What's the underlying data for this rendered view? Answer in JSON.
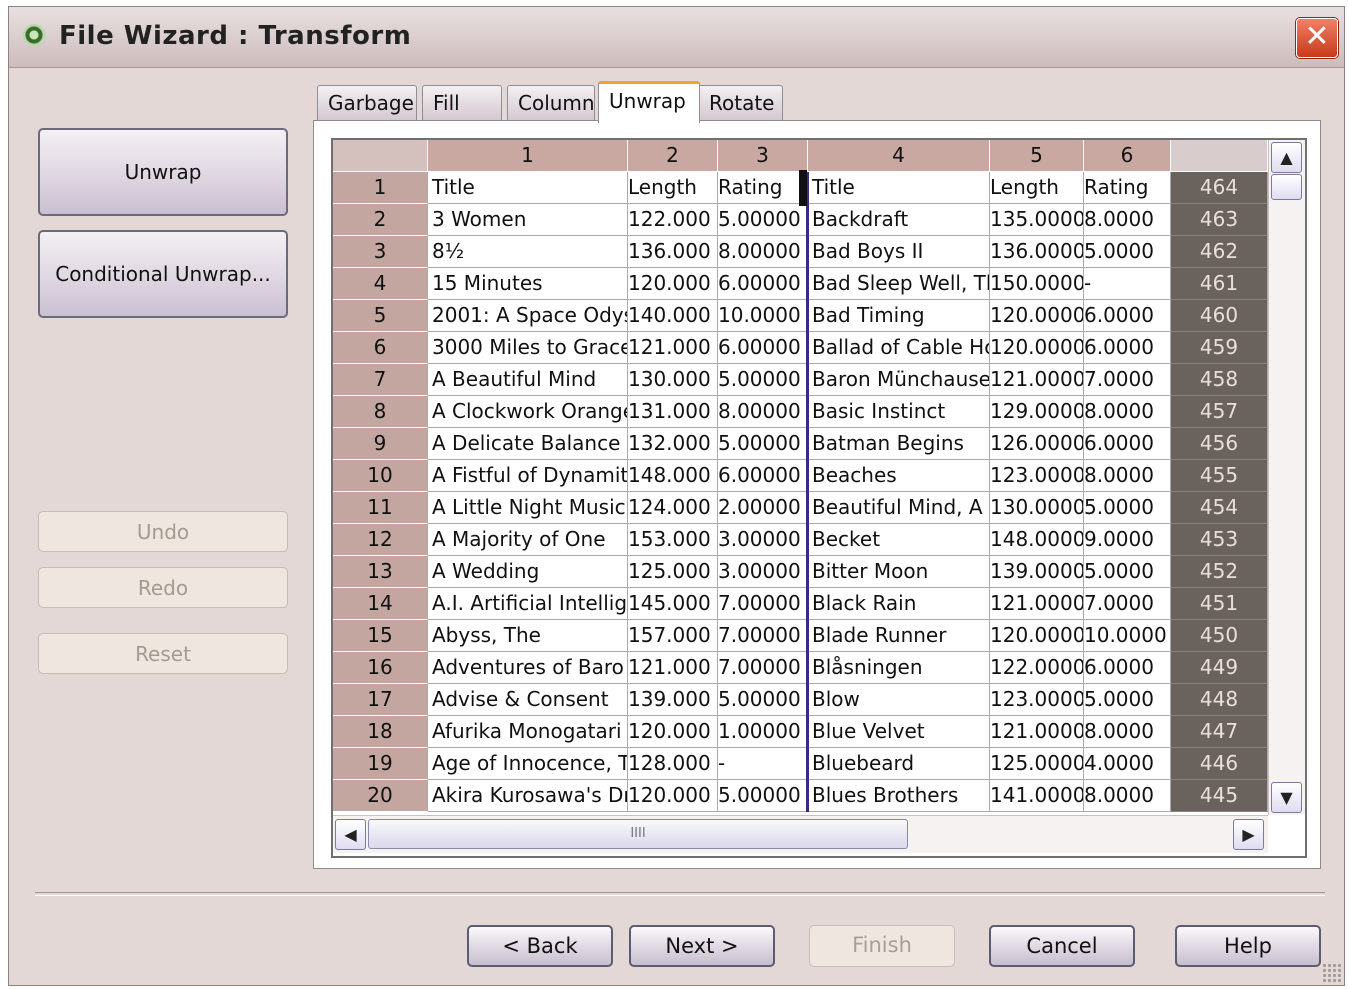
{
  "window": {
    "title": "File Wizard : Transform"
  },
  "sidebar": {
    "unwrap": "Unwrap",
    "conditional_unwrap": "Conditional Unwrap...",
    "undo": "Undo",
    "redo": "Redo",
    "reset": "Reset"
  },
  "tabs": [
    "Garbage",
    "Fill",
    "Column",
    "Unwrap",
    "Rotate"
  ],
  "active_tab": "Unwrap",
  "grid": {
    "col_headers": [
      "1",
      "2",
      "3",
      "4",
      "5",
      "6"
    ],
    "rows": [
      {
        "n": "1",
        "c": [
          "Title",
          "Length",
          "Rating",
          "Title",
          "Length",
          "Rating"
        ],
        "r": "464"
      },
      {
        "n": "2",
        "c": [
          "3 Women",
          "122.000",
          "5.00000",
          "Backdraft",
          "135.0000",
          "8.0000"
        ],
        "r": "463"
      },
      {
        "n": "3",
        "c": [
          "8½",
          "136.000",
          "8.00000",
          "Bad Boys II",
          "136.0000",
          "5.0000"
        ],
        "r": "462"
      },
      {
        "n": "4",
        "c": [
          "15 Minutes",
          "120.000",
          "6.00000",
          "Bad Sleep Well, Th",
          "150.0000",
          "-"
        ],
        "r": "461"
      },
      {
        "n": "5",
        "c": [
          "2001: A Space Odys",
          "140.000",
          "10.0000",
          "Bad Timing",
          "120.0000",
          "6.0000"
        ],
        "r": "460"
      },
      {
        "n": "6",
        "c": [
          "3000 Miles to Grace",
          "121.000",
          "6.00000",
          "Ballad of Cable Hc",
          "120.0000",
          "6.0000"
        ],
        "r": "459"
      },
      {
        "n": "7",
        "c": [
          "A Beautiful Mind",
          "130.000",
          "5.00000",
          "Baron Münchause",
          "121.0000",
          "7.0000"
        ],
        "r": "458"
      },
      {
        "n": "8",
        "c": [
          "A Clockwork Orange",
          "131.000",
          "8.00000",
          "Basic Instinct",
          "129.0000",
          "8.0000"
        ],
        "r": "457"
      },
      {
        "n": "9",
        "c": [
          "A Delicate Balance",
          "132.000",
          "5.00000",
          "Batman Begins",
          "126.0000",
          "6.0000"
        ],
        "r": "456"
      },
      {
        "n": "10",
        "c": [
          "A Fistful of Dynamit",
          "148.000",
          "6.00000",
          "Beaches",
          "123.0000",
          "8.0000"
        ],
        "r": "455"
      },
      {
        "n": "11",
        "c": [
          "A Little Night Music",
          "124.000",
          "2.00000",
          "Beautiful Mind, A",
          "130.0000",
          "5.0000"
        ],
        "r": "454"
      },
      {
        "n": "12",
        "c": [
          "A Majority of One",
          "153.000",
          "3.00000",
          "Becket",
          "148.0000",
          "9.0000"
        ],
        "r": "453"
      },
      {
        "n": "13",
        "c": [
          "A Wedding",
          "125.000",
          "3.00000",
          "Bitter Moon",
          "139.0000",
          "5.0000"
        ],
        "r": "452"
      },
      {
        "n": "14",
        "c": [
          "A.I. Artificial Intellig",
          "145.000",
          "7.00000",
          "Black Rain",
          "121.0000",
          "7.0000"
        ],
        "r": "451"
      },
      {
        "n": "15",
        "c": [
          "Abyss, The",
          "157.000",
          "7.00000",
          "Blade Runner",
          "120.0000",
          "10.0000"
        ],
        "r": "450"
      },
      {
        "n": "16",
        "c": [
          "Adventures of Baro",
          "121.000",
          "7.00000",
          "Blåsningen",
          "122.0000",
          "6.0000"
        ],
        "r": "449"
      },
      {
        "n": "17",
        "c": [
          "Advise & Consent",
          "139.000",
          "5.00000",
          "Blow",
          "123.0000",
          "5.0000"
        ],
        "r": "448"
      },
      {
        "n": "18",
        "c": [
          "Afurika Monogatari",
          "120.000",
          "1.00000",
          "Blue Velvet",
          "121.0000",
          "8.0000"
        ],
        "r": "447"
      },
      {
        "n": "19",
        "c": [
          "Age of Innocence, T",
          "128.000",
          "-",
          "Bluebeard",
          "125.0000",
          "4.0000"
        ],
        "r": "446"
      },
      {
        "n": "20",
        "c": [
          "Akira Kurosawa's Dr",
          "120.000",
          "5.00000",
          "Blues Brothers",
          "141.0000",
          "8.0000"
        ],
        "r": "445"
      }
    ]
  },
  "scroll": {
    "up": "▲",
    "down": "▼",
    "left": "◀",
    "right": "▶",
    "grip": "IIII"
  },
  "footer": {
    "back": "< Back",
    "next": "Next >",
    "finish": "Finish",
    "cancel": "Cancel",
    "help": "Help"
  },
  "icons": {
    "app": "qlikview-app-icon",
    "close": "close-icon"
  }
}
